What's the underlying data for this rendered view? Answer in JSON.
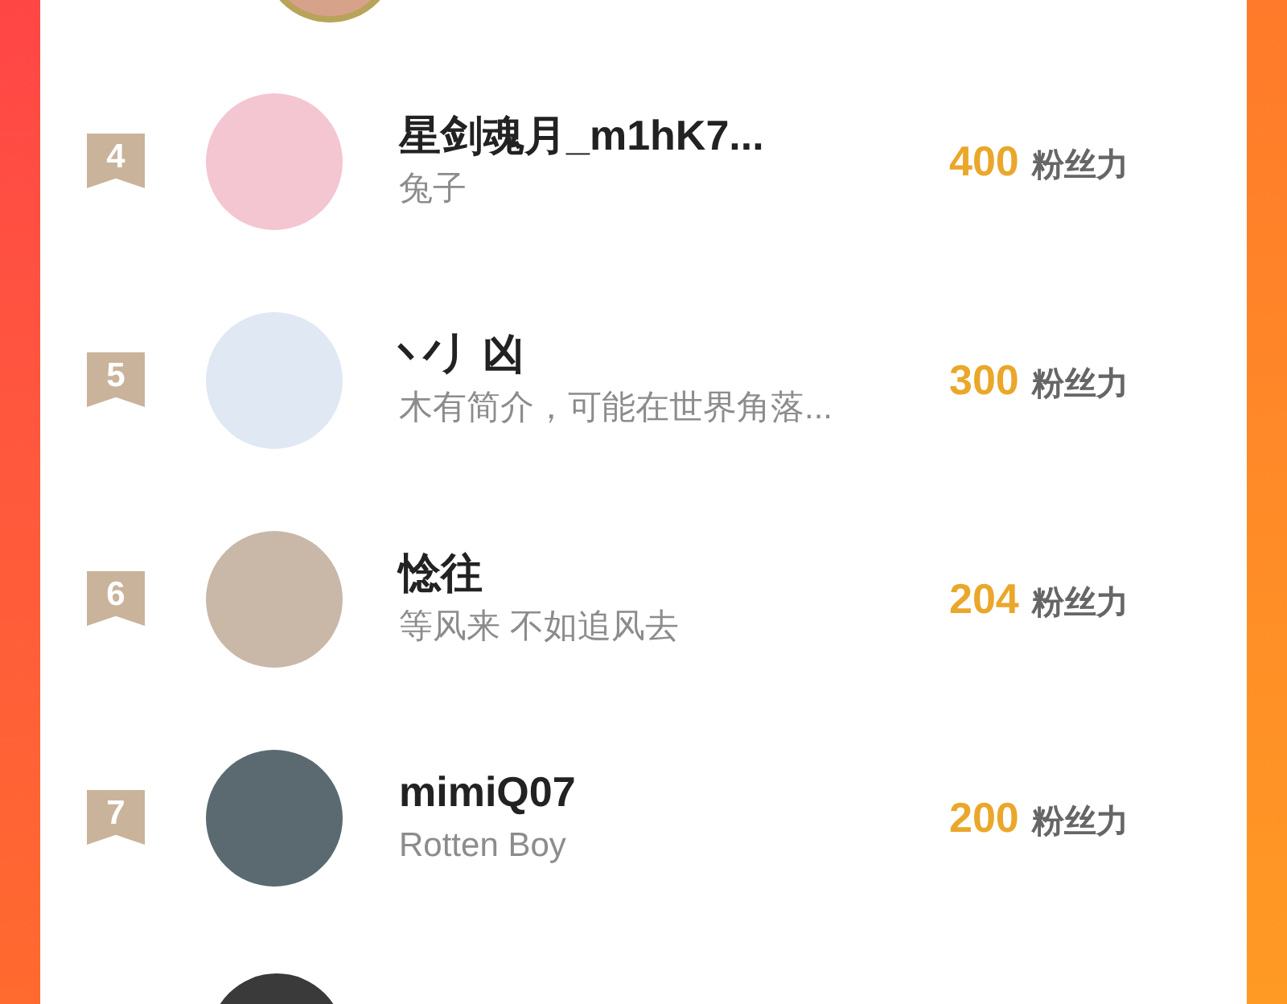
{
  "fans": [
    {
      "rank": "4",
      "name": "星剑魂月_m1hK7...",
      "bio": "兔子",
      "count": "400",
      "unit": "粉丝力"
    },
    {
      "rank": "5",
      "name": "丷丿凶",
      "bio": "木有简介，可能在世界角落...",
      "count": "300",
      "unit": "粉丝力"
    },
    {
      "rank": "6",
      "name": "惗往",
      "bio": "等风来 不如追风去",
      "count": "204",
      "unit": "粉丝力"
    },
    {
      "rank": "7",
      "name": "mimiQ07",
      "bio": "Rotten Boy",
      "count": "200",
      "unit": "粉丝力"
    }
  ]
}
